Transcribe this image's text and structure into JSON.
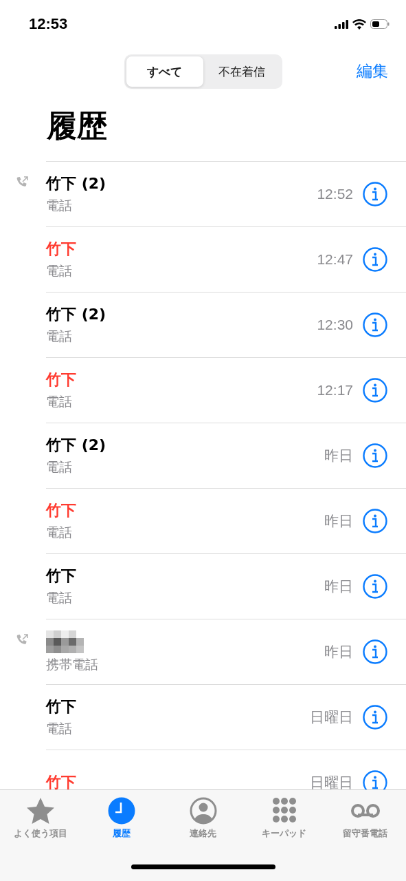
{
  "status_bar": {
    "time": "12:53"
  },
  "segments": [
    {
      "label": "すべて",
      "selected": true
    },
    {
      "label": "不在着信",
      "selected": false
    }
  ],
  "edit_button": "編集",
  "title": "履歴",
  "calls": [
    {
      "kind": "contact",
      "name": "竹下 (2)",
      "missed": false,
      "outgoing": true,
      "type": "電話",
      "time": "12:52"
    },
    {
      "kind": "contact",
      "name": "竹下",
      "missed": true,
      "outgoing": false,
      "type": "電話",
      "time": "12:47"
    },
    {
      "kind": "contact",
      "name": "竹下 (2)",
      "missed": false,
      "outgoing": false,
      "type": "電話",
      "time": "12:30"
    },
    {
      "kind": "contact",
      "name": "竹下",
      "missed": true,
      "outgoing": false,
      "type": "電話",
      "time": "12:17"
    },
    {
      "kind": "contact",
      "name": "竹下 (2)",
      "missed": false,
      "outgoing": false,
      "type": "電話",
      "time": "昨日"
    },
    {
      "kind": "contact",
      "name": "竹下",
      "missed": true,
      "outgoing": false,
      "type": "電話",
      "time": "昨日"
    },
    {
      "kind": "contact",
      "name": "竹下",
      "missed": false,
      "outgoing": false,
      "type": "電話",
      "time": "昨日"
    },
    {
      "kind": "redacted",
      "outgoing": true,
      "type": "携帯電話",
      "time": "昨日"
    },
    {
      "kind": "contact",
      "name": "竹下",
      "missed": false,
      "outgoing": false,
      "type": "電話",
      "time": "日曜日"
    },
    {
      "kind": "contact",
      "name": "竹下",
      "missed": true,
      "outgoing": false,
      "time": "日曜日"
    }
  ],
  "tab_bar": [
    {
      "kind": "star",
      "label": "よく使う項目",
      "selected": false
    },
    {
      "kind": "clock",
      "label": "履歴",
      "selected": true
    },
    {
      "kind": "person",
      "label": "連絡先",
      "selected": false
    },
    {
      "kind": "keypad",
      "label": "キーパッド",
      "selected": false
    },
    {
      "kind": "voicemail",
      "label": "留守番電話",
      "selected": false
    }
  ]
}
